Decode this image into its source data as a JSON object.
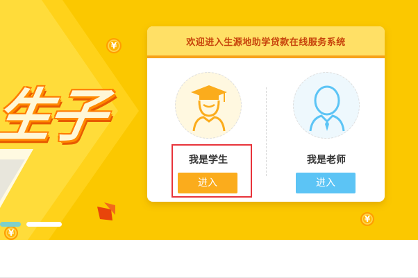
{
  "system_title": "欢迎进入生源地助学贷款在线服务系统",
  "banner": {
    "hero_glyphs": "生子",
    "coin_symbol": "¥"
  },
  "roles": [
    {
      "label": "我是学生",
      "button": "进入",
      "button_color": "#fbac1c"
    },
    {
      "label": "我是老师",
      "button": "进入",
      "button_color": "#5cc4f5"
    }
  ],
  "colors": {
    "banner_bg": "#fbc800",
    "header_bg": "#ffe066",
    "header_border": "#f7a21b",
    "highlight": "#e8333a"
  }
}
